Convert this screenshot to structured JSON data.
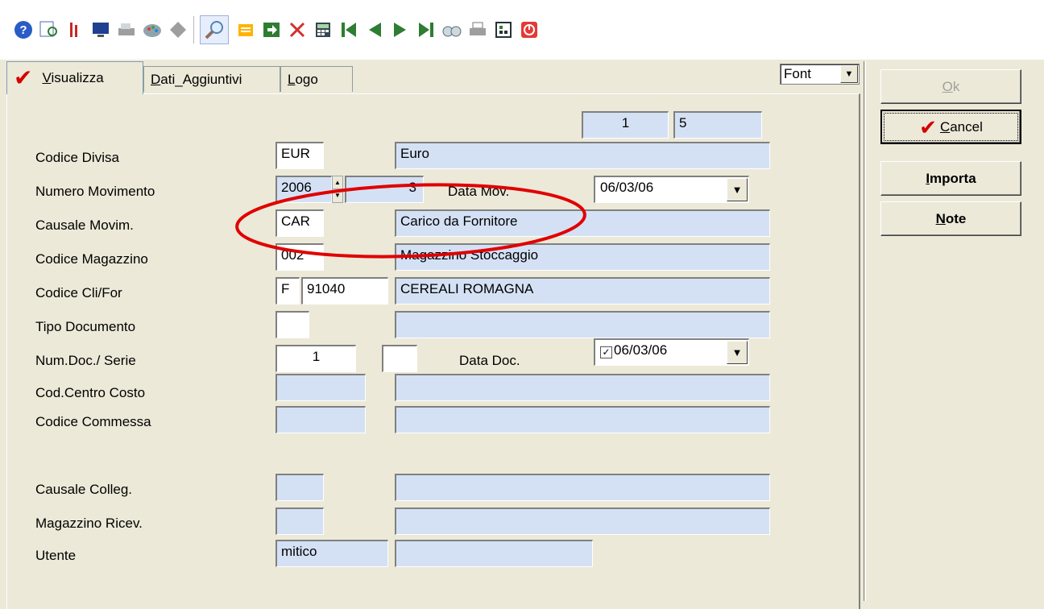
{
  "toolbar": {
    "icons": [
      "help-icon",
      "find-doc-icon",
      "ruler-icon",
      "monitor-icon",
      "scanner-icon",
      "palette-icon",
      "diamond-icon",
      "search-icon",
      "folder-icon",
      "enter-icon",
      "delete-icon",
      "calculator-icon",
      "first-record-icon",
      "prev-record-icon",
      "next-record-icon",
      "last-record-icon",
      "binoculars-icon",
      "print-icon",
      "structure-icon",
      "power-icon"
    ]
  },
  "tabs": [
    {
      "label": "Visualizza",
      "accel": "V",
      "rest": "isualizza",
      "active": true
    },
    {
      "label": "Dati_Aggiuntivi",
      "accel": "D",
      "rest": "ati_Aggiuntivi",
      "active": false
    },
    {
      "label": "Logo",
      "accel": "L",
      "rest": "ogo",
      "active": false
    }
  ],
  "font_select": {
    "value": "Font"
  },
  "record_counter": {
    "current": "1",
    "total": "5"
  },
  "form": {
    "codice_divisa": {
      "label": "Codice Divisa",
      "code": "EUR",
      "desc": "Euro"
    },
    "numero_movimento": {
      "label": "Numero Movimento",
      "year": "2006",
      "number": "3"
    },
    "data_mov": {
      "label": "Data Mov.",
      "value": "06/03/06"
    },
    "causale_movim": {
      "label": "Causale Movim.",
      "code": "CAR",
      "desc": "Carico da Fornitore"
    },
    "codice_magazzino": {
      "label": "Codice Magazzino",
      "code": "002",
      "desc": "Magazzino Stoccaggio"
    },
    "codice_cli_for": {
      "label": "Codice Cli/For",
      "type": "F",
      "code": "91040",
      "desc": "CEREALI ROMAGNA"
    },
    "tipo_documento": {
      "label": "Tipo Documento",
      "code": "",
      "desc": ""
    },
    "num_doc_serie": {
      "label": "Num.Doc./ Serie",
      "number": "1",
      "serie": ""
    },
    "data_doc": {
      "label": "Data Doc.",
      "value": "06/03/06",
      "checked": true,
      "check_glyph": "✓"
    },
    "cod_centro_costo": {
      "label": "Cod.Centro Costo",
      "code": "",
      "desc": ""
    },
    "codice_commessa": {
      "label": "Codice Commessa",
      "code": "",
      "desc": ""
    },
    "causale_colleg": {
      "label": "Causale Colleg.",
      "code": "",
      "desc": ""
    },
    "magazzino_ricev": {
      "label": "Magazzino Ricev.",
      "code": "",
      "desc": ""
    },
    "utente": {
      "label": "Utente",
      "code": "mitico",
      "desc": ""
    }
  },
  "buttons": {
    "ok": {
      "accel": "O",
      "rest": "k"
    },
    "cancel": {
      "accel": "C",
      "rest": "ancel"
    },
    "importa": {
      "accel": "I",
      "rest": "mporta"
    },
    "note": {
      "accel": "N",
      "rest": "ote"
    }
  },
  "colors": {
    "field_bg": "#d4e1f5",
    "accent_red": "#d40000",
    "window_bg": "#ece9d8"
  }
}
